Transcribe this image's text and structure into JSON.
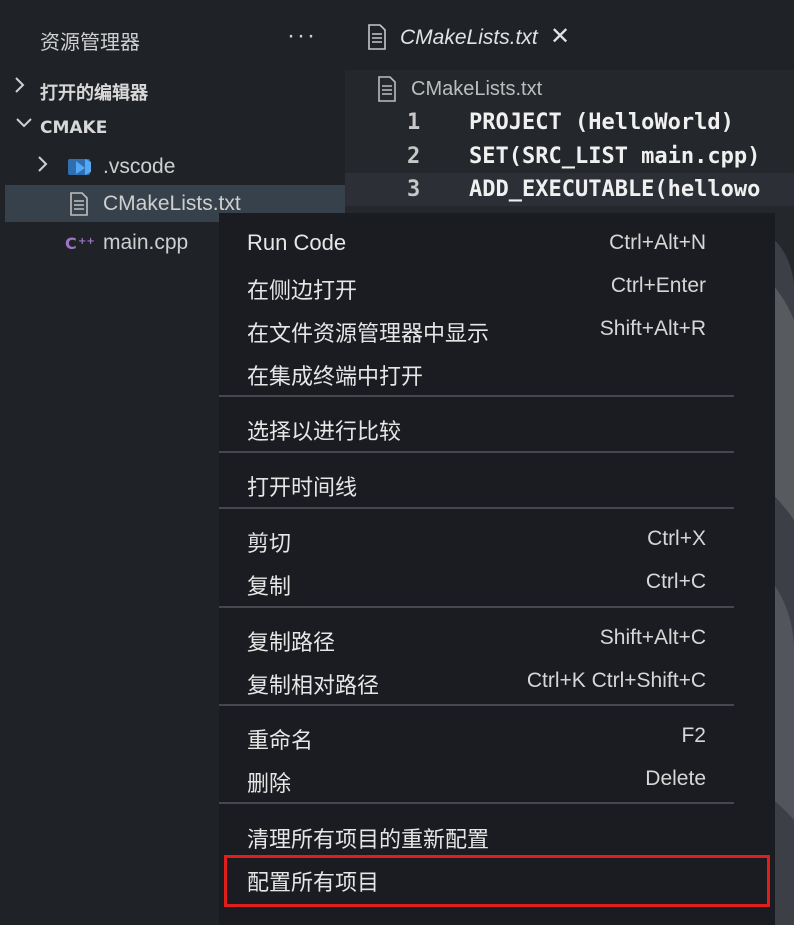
{
  "explorer": {
    "title": "资源管理器",
    "more_label": "···",
    "open_editors_label": "打开的编辑器",
    "project_label": "CMAKE",
    "items": [
      {
        "label": ".vscode",
        "icon": "vscode-folder-icon"
      },
      {
        "label": "CMakeLists.txt",
        "icon": "file-text-icon"
      },
      {
        "label": "main.cpp",
        "icon": "cpp-file-icon"
      }
    ]
  },
  "editor": {
    "tab": {
      "title": "CMakeLists.txt",
      "close": "✕"
    },
    "breadcrumb": "CMakeLists.txt",
    "lines": [
      {
        "num": "1",
        "code": "PROJECT (HelloWorld)"
      },
      {
        "num": "2",
        "code": "SET(SRC_LIST main.cpp)"
      },
      {
        "num": "3",
        "code": "ADD_EXECUTABLE(hellowo"
      }
    ]
  },
  "context_menu": {
    "items": [
      {
        "label": "Run Code",
        "shortcut": "Ctrl+Alt+N"
      },
      {
        "label": "在侧边打开",
        "shortcut": "Ctrl+Enter"
      },
      {
        "label": "在文件资源管理器中显示",
        "shortcut": "Shift+Alt+R"
      },
      {
        "label": "在集成终端中打开",
        "shortcut": ""
      },
      {
        "label": "选择以进行比较",
        "shortcut": ""
      },
      {
        "label": "打开时间线",
        "shortcut": ""
      },
      {
        "label": "剪切",
        "shortcut": "Ctrl+X"
      },
      {
        "label": "复制",
        "shortcut": "Ctrl+C"
      },
      {
        "label": "复制路径",
        "shortcut": "Shift+Alt+C"
      },
      {
        "label": "复制相对路径",
        "shortcut": "Ctrl+K Ctrl+Shift+C"
      },
      {
        "label": "重命名",
        "shortcut": "F2"
      },
      {
        "label": "删除",
        "shortcut": "Delete"
      },
      {
        "label": "清理所有项目的重新配置",
        "shortcut": ""
      },
      {
        "label": "配置所有项目",
        "shortcut": ""
      }
    ]
  },
  "colors": {
    "highlight_border": "#e01e1e",
    "cpp_icon": "#a074c4",
    "vscode_icon": "#3b8eea"
  }
}
